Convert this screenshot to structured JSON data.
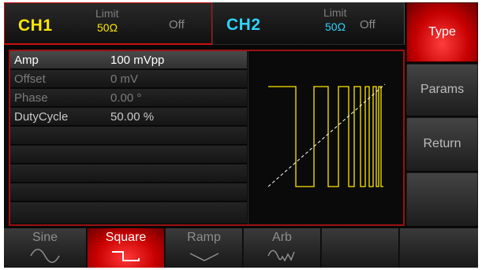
{
  "channels": [
    {
      "name": "CH1",
      "limit_label": "Limit",
      "impedance": "50Ω",
      "state": "Off",
      "color": "#ffe800"
    },
    {
      "name": "CH2",
      "limit_label": "Limit",
      "impedance": "50Ω",
      "state": "Off",
      "color": "#2fd4ff"
    }
  ],
  "softkeys": [
    {
      "label": "Type",
      "active": true
    },
    {
      "label": "Params",
      "active": false
    },
    {
      "label": "Return",
      "active": false
    },
    {
      "label": "",
      "active": false
    }
  ],
  "params": [
    {
      "name": "Amp",
      "value": "100 mVpp",
      "selected": true
    },
    {
      "name": "Offset",
      "value": "0 mV",
      "selected": false
    },
    {
      "name": "Phase",
      "value": "0.00 °",
      "selected": false
    },
    {
      "name": "DutyCycle",
      "value": "50.00 %",
      "selected": false
    }
  ],
  "waveform": {
    "type": "square",
    "duty_cycle_percent": 50,
    "trace_color": "#ffe800"
  },
  "tabs": [
    {
      "label": "Sine",
      "icon": "sine-wave-icon",
      "active": false
    },
    {
      "label": "Square",
      "icon": "square-wave-icon",
      "active": true
    },
    {
      "label": "Ramp",
      "icon": "ramp-wave-icon",
      "active": false
    },
    {
      "label": "Arb",
      "icon": "arbitrary-wave-icon",
      "active": false
    },
    {
      "label": "",
      "icon": "",
      "active": false
    },
    {
      "label": "",
      "icon": "",
      "active": false
    }
  ],
  "colors": {
    "accent_red": "#c80000",
    "ch1": "#ffe800",
    "ch2": "#2fd4ff"
  }
}
